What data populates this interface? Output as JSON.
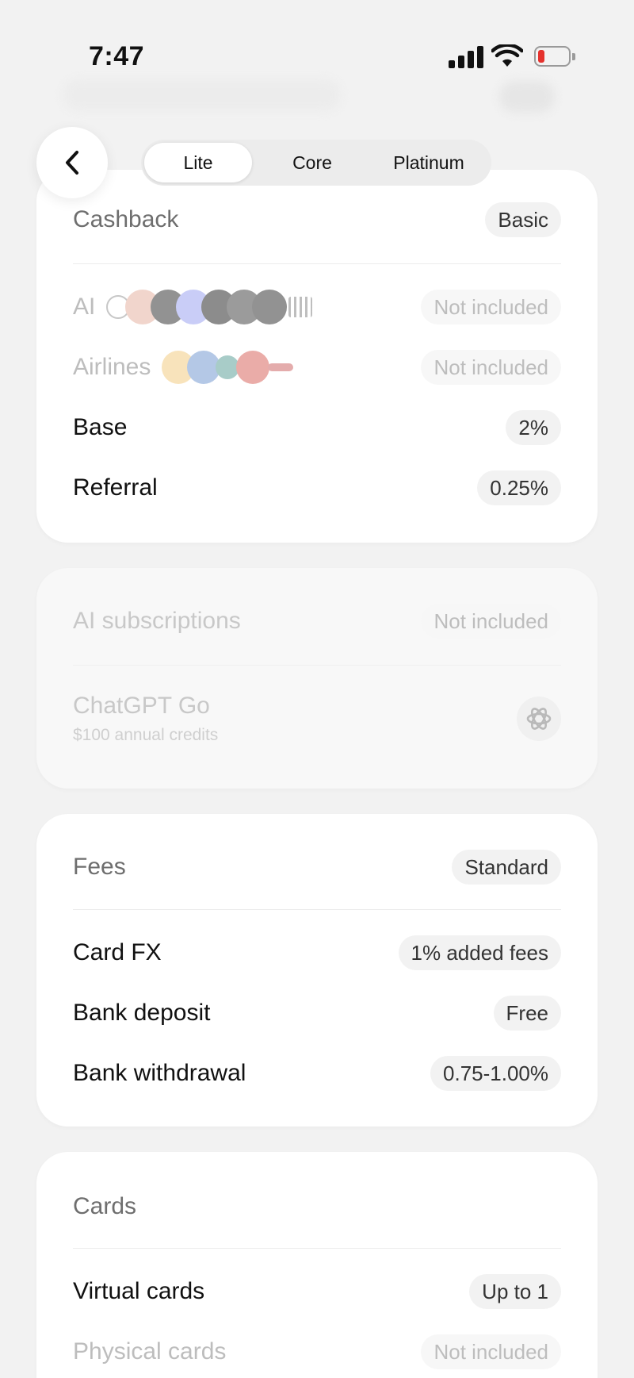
{
  "status_bar": {
    "time": "7:47"
  },
  "nav": {
    "tabs": [
      {
        "label": "Lite",
        "active": true
      },
      {
        "label": "Core",
        "active": false
      },
      {
        "label": "Platinum",
        "active": false
      }
    ]
  },
  "cashback": {
    "title": "Cashback",
    "badge": "Basic",
    "rows": [
      {
        "label": "AI",
        "value": "Not included"
      },
      {
        "label": "Airlines",
        "value": "Not included"
      },
      {
        "label": "Base",
        "value": "2%"
      },
      {
        "label": "Referral",
        "value": "0.25%"
      }
    ]
  },
  "ai_subscriptions": {
    "title": "AI subscriptions",
    "value": "Not included",
    "item_title": "ChatGPT Go",
    "item_subtitle": "$100 annual credits"
  },
  "fees": {
    "title": "Fees",
    "badge": "Standard",
    "rows": [
      {
        "label": "Card FX",
        "value": "1% added fees"
      },
      {
        "label": "Bank deposit",
        "value": "Free"
      },
      {
        "label": "Bank withdrawal",
        "value": "0.75-1.00%"
      }
    ]
  },
  "cards": {
    "title": "Cards",
    "rows": [
      {
        "label": "Virtual cards",
        "value": "Up to 1"
      },
      {
        "label": "Physical cards",
        "value": "Not included"
      }
    ]
  },
  "colors": {
    "background": "#f2f2f2",
    "card": "#ffffff",
    "battery_low": "#e5322d"
  },
  "icons": [
    "back-chevron-icon",
    "signal-icon",
    "wifi-icon",
    "battery-icon",
    "openai-icon"
  ]
}
